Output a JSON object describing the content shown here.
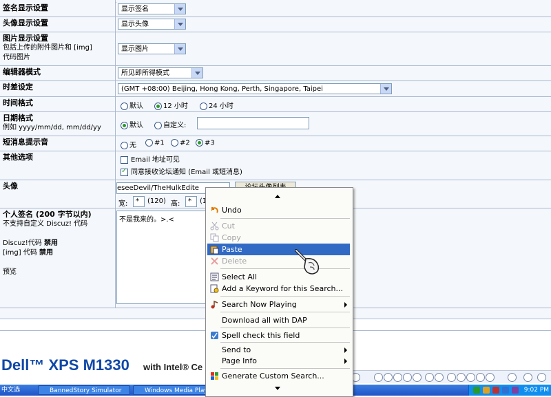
{
  "form": {
    "sig_display": {
      "label": "签名显示设置",
      "value": "显示签名"
    },
    "avatar_display": {
      "label": "头像显示设置",
      "value": "显示头像"
    },
    "image_display": {
      "label": "图片显示设置",
      "sub1": "包括上传的附件图片和 [img]",
      "sub2": "代码图片",
      "value": "显示图片"
    },
    "editor_mode": {
      "label": "编辑器模式",
      "value": "所见即所得模式"
    },
    "timezone": {
      "label": "时差设定",
      "value": "(GMT +08:00) Beijing, Hong Kong, Perth, Singapore, Taipei"
    },
    "time_format": {
      "label": "时间格式",
      "options": [
        "默认",
        "12 小时",
        "24 小时"
      ],
      "selected": "12 小时"
    },
    "date_format": {
      "label": "日期格式",
      "sub": "例如 yyyy/mm/dd, mm/dd/yy",
      "options": [
        "默认",
        "自定义:"
      ],
      "selected": "默认"
    },
    "pm_sound": {
      "label": "短消息提示音",
      "options": [
        "无",
        "#1",
        "#2",
        "#3"
      ],
      "selected": "#3"
    },
    "other": {
      "label": "其他选项",
      "opt1": "Email 地址可见",
      "opt2": "同意接收论坛通知 (Email 或短消息)"
    },
    "avatar": {
      "label": "头像",
      "url": "eseeDevil/TheHulkEdite",
      "button": "论坛头像列表",
      "width_label": "宽:",
      "width_value": "*",
      "width_hint": "(120)",
      "height_label": "高:",
      "height_value": "*",
      "height_hint": "(1"
    },
    "signature": {
      "label": "个人签名 (200 字节以内)",
      "line1": "不支持自定义 Discuz! 代码",
      "discuz_code": "Discuz!代码",
      "img_code": "[img] 代码",
      "disabled": "禁用",
      "preview": "预览",
      "text": "不是我来的。>.<"
    }
  },
  "context_menu": {
    "undo": "Undo",
    "cut": "Cut",
    "copy": "Copy",
    "paste": "Paste",
    "delete": "Delete",
    "select_all": "Select All",
    "add_keyword": "Add a Keyword for this Search...",
    "search_now_playing": "Search Now Playing",
    "download_dap": "Download all with DAP",
    "spell_check": "Spell check this field",
    "send_to": "Send to",
    "page_info": "Page Info",
    "custom_search": "Generate Custom Search..."
  },
  "ad": {
    "brand": "Dell™ XPS M1330",
    "tagline": "with Intel® Ce"
  },
  "taskbar": {
    "start": "中文选",
    "items": [
      "BannedStory Simulator",
      "Windows Media Playe"
    ],
    "clock": "9:02 PM"
  }
}
